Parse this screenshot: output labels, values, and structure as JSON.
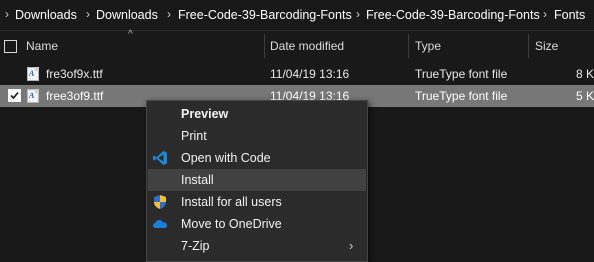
{
  "breadcrumbs": [
    "Downloads",
    "Downloads",
    "Free-Code-39-Barcoding-Fonts",
    "Free-Code-39-Barcoding-Fonts",
    "Fonts"
  ],
  "columns": {
    "name": "Name",
    "date_modified": "Date modified",
    "type": "Type",
    "size": "Size"
  },
  "files": [
    {
      "name": "fre3of9x.ttf",
      "date": "11/04/19 13:16",
      "type": "TrueType font file",
      "size": "8 K",
      "selected": false
    },
    {
      "name": "free3of9.ttf",
      "date": "11/04/19 13:16",
      "type": "TrueType font file",
      "size": "5 K",
      "selected": true
    }
  ],
  "context_menu": {
    "items": [
      {
        "label": "Preview",
        "bold": true
      },
      {
        "label": "Print"
      },
      {
        "label": "Open with Code",
        "icon": "vscode-icon"
      },
      {
        "label": "Install",
        "hover": true
      },
      {
        "label": "Install for all users",
        "icon": "uac-shield-icon"
      },
      {
        "label": "Move to OneDrive",
        "icon": "onedrive-icon"
      },
      {
        "label": "7-Zip",
        "submenu": true
      }
    ]
  },
  "colors": {
    "background": "#191919",
    "selection": "#777777",
    "menu_bg": "#2b2b2b",
    "menu_hover": "#414141",
    "vscode_blue": "#1e88d6",
    "onedrive_blue": "#1a7fd6"
  }
}
